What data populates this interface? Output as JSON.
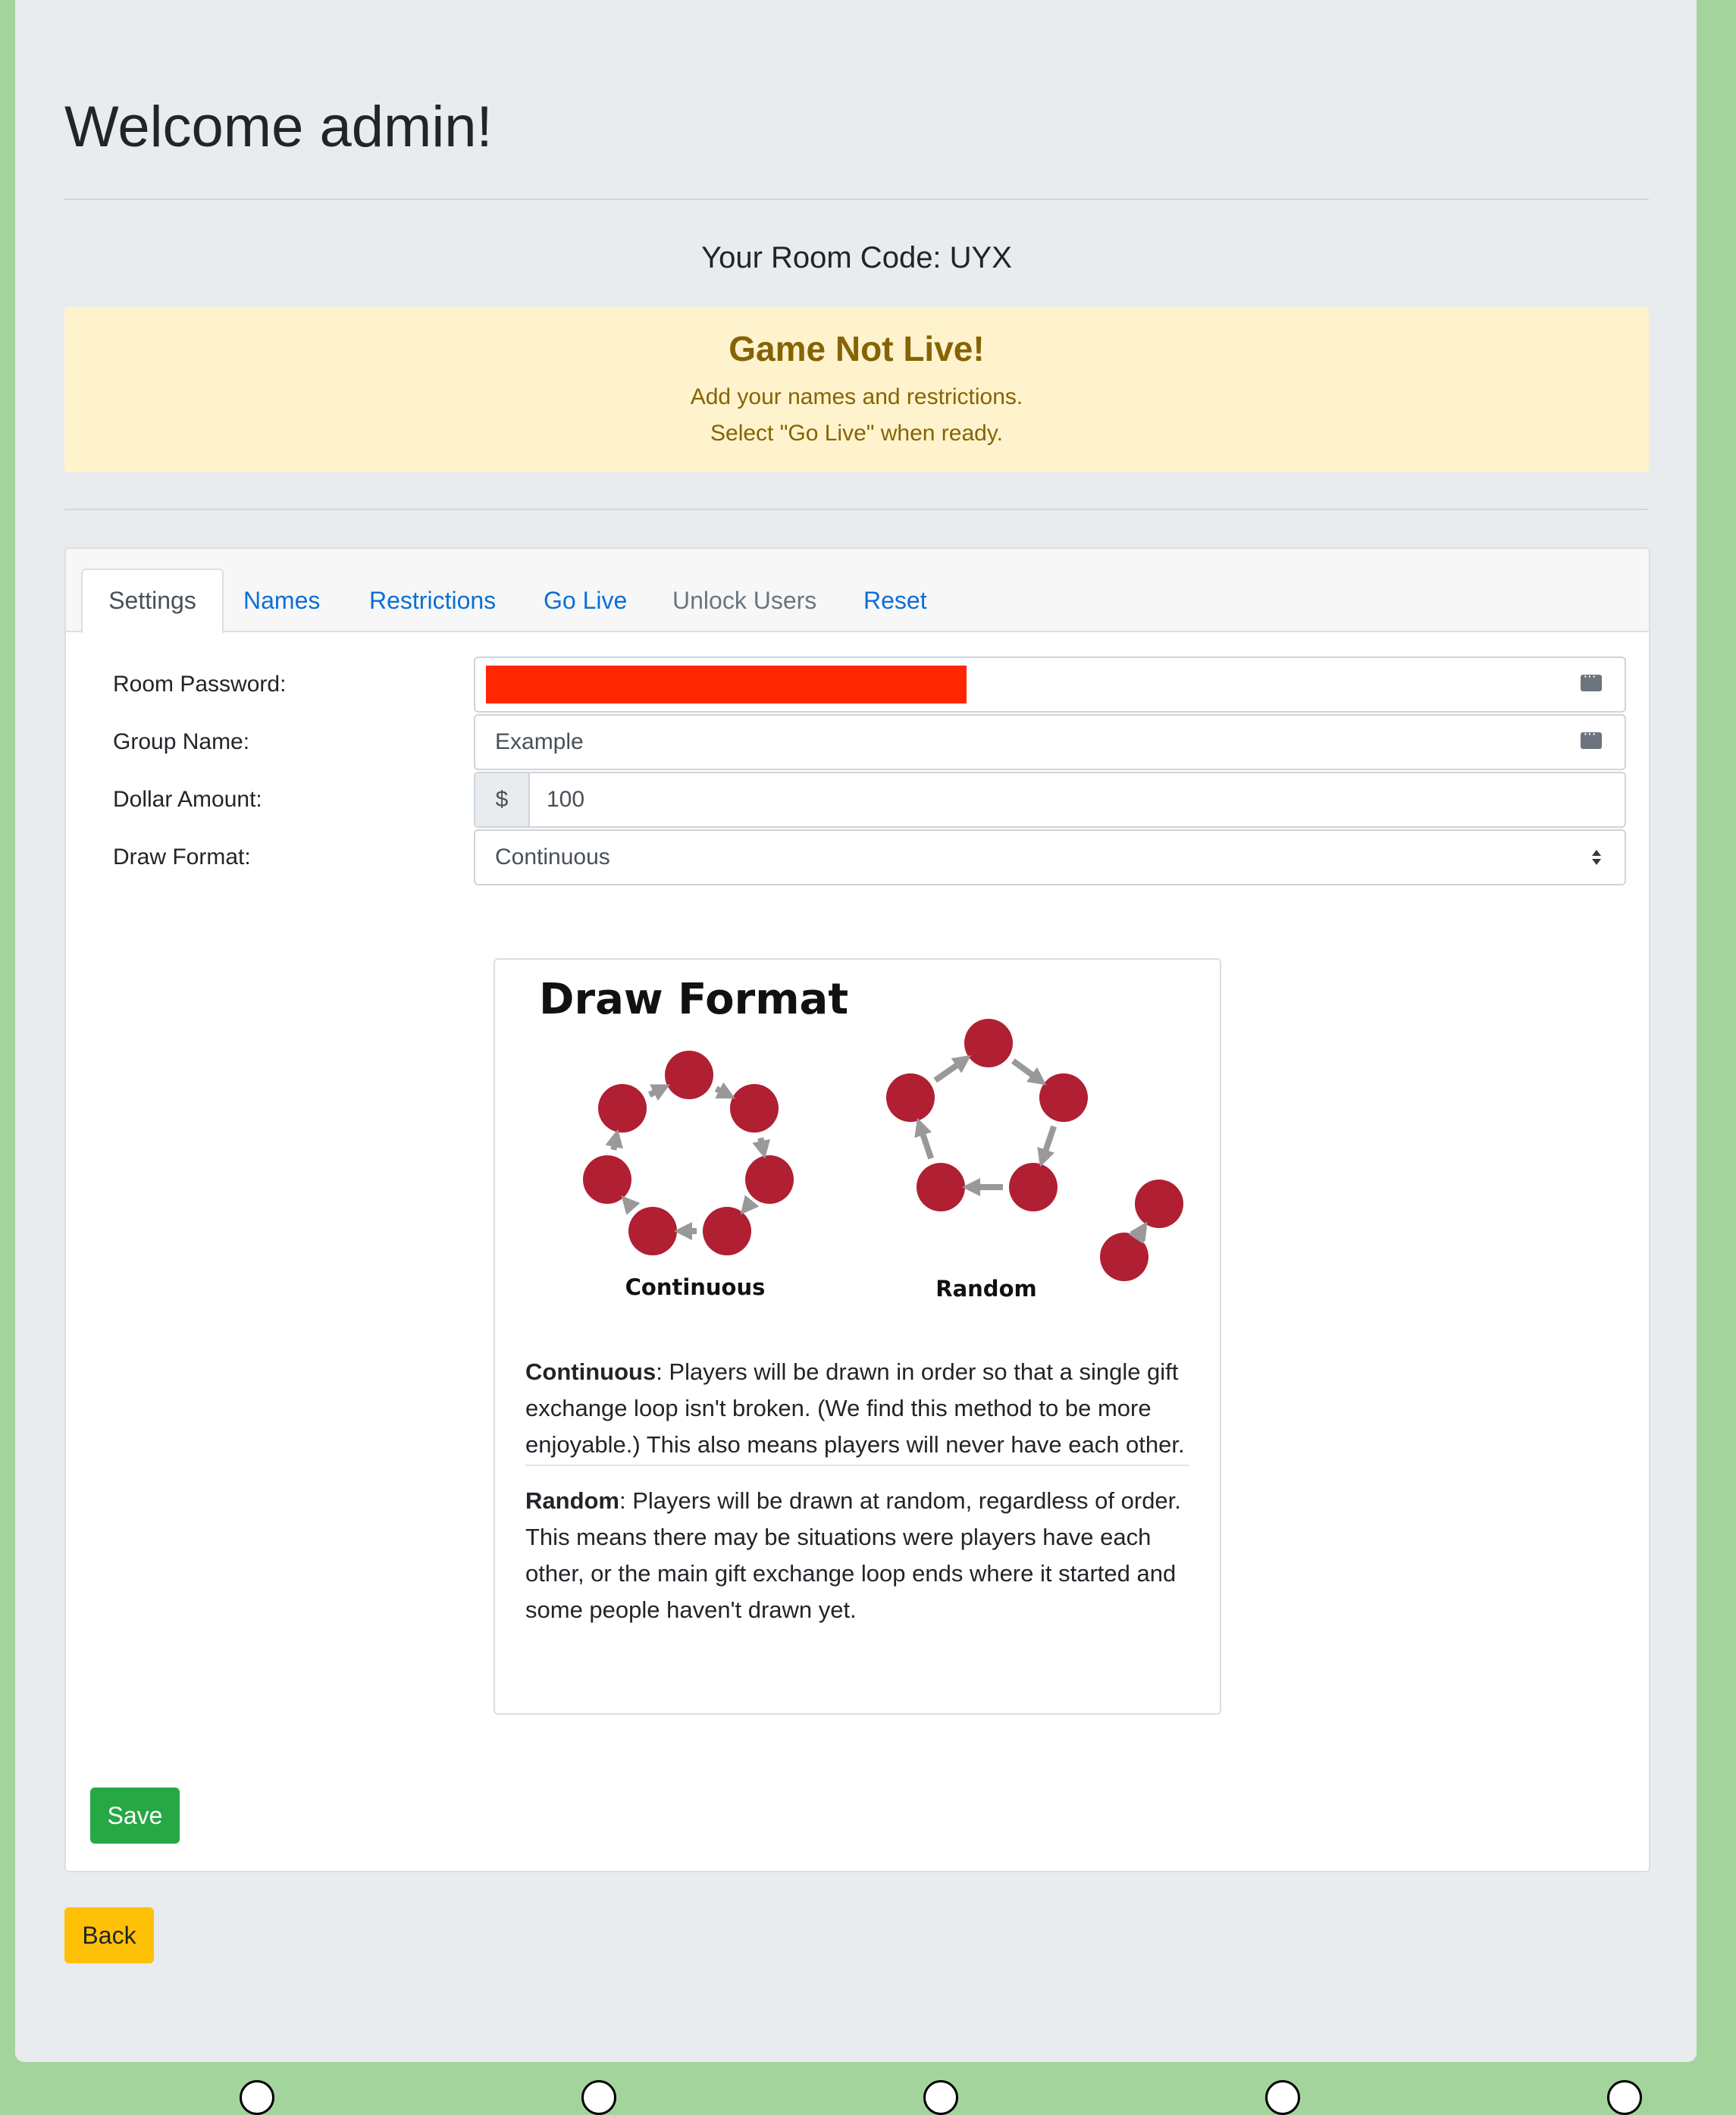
{
  "header": {
    "title": "Welcome admin!"
  },
  "room": {
    "label": "Your Room Code:",
    "code": "UYX"
  },
  "alert": {
    "title": "Game Not Live!",
    "line1": "Add your names and restrictions.",
    "line2": "Select \"Go Live\" when ready."
  },
  "tabs": [
    {
      "label": "Settings",
      "state": "active"
    },
    {
      "label": "Names",
      "state": "link"
    },
    {
      "label": "Restrictions",
      "state": "link"
    },
    {
      "label": "Go Live",
      "state": "link"
    },
    {
      "label": "Unlock Users",
      "state": "disabled"
    },
    {
      "label": "Reset",
      "state": "link"
    }
  ],
  "form": {
    "password_label": "Room Password:",
    "group_label": "Group Name:",
    "group_value": "Example",
    "dollar_label": "Dollar Amount:",
    "dollar_prefix": "$",
    "dollar_value": "100",
    "format_label": "Draw Format:",
    "format_value": "Continuous"
  },
  "diagram": {
    "title": "Draw Format",
    "continuous_caption": "Continuous",
    "random_caption": "Random",
    "circle_color": "#b01f32",
    "arrow_color": "#999999"
  },
  "descriptions": {
    "continuous_term": "Continuous",
    "continuous_text": ": Players will be drawn in order so that a single gift exchange loop isn't broken. (We find this method to be more enjoyable.) This also means players will never have each other.",
    "random_term": "Random",
    "random_text": ": Players will be drawn at random, regardless of order. This means there may be situations were players have each other, or the main gift exchange loop ends where it started and some people haven't drawn yet."
  },
  "buttons": {
    "save": "Save",
    "back": "Back"
  }
}
